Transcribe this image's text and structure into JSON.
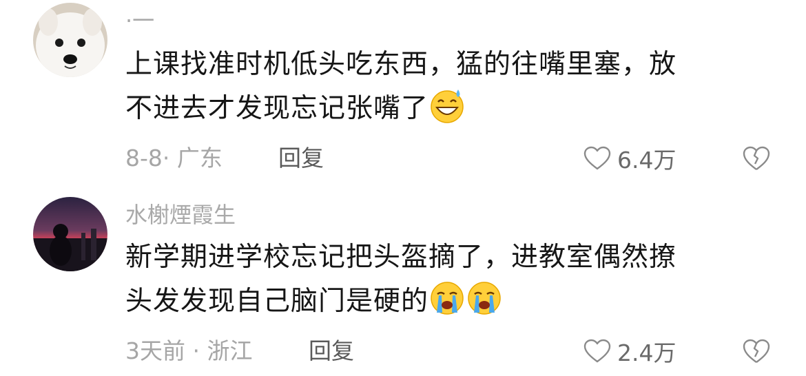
{
  "comments": [
    {
      "username": "·一",
      "line1": "上课找准时机低头吃东西，猛的往嘴里塞，放",
      "line2": "不进去才发现忘记张嘴了",
      "emojis": [
        "grinning-sweat-face"
      ],
      "meta": "8-8· 广东",
      "reply_label": "回复",
      "likes": "6.4万"
    },
    {
      "username": "水榭煙霞生",
      "line1": "新学期进学校忘记把头盔摘了，进教室偶然撩",
      "line2": "头发发现自己脑门是硬的",
      "emojis": [
        "loudly-crying-face",
        "loudly-crying-face"
      ],
      "meta": "3天前 · 浙江",
      "reply_label": "回复",
      "likes": "2.4万"
    }
  ]
}
